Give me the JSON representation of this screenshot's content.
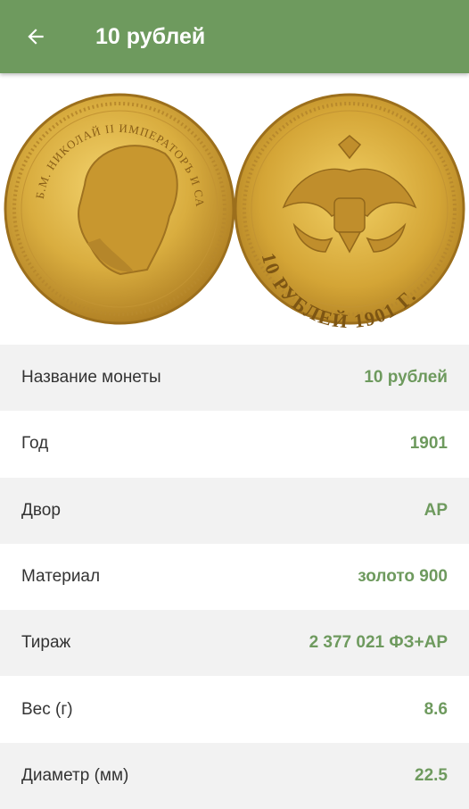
{
  "appbar": {
    "title": "10 рублей",
    "back_icon": "arrow-left-icon",
    "background": "#6e9a5e"
  },
  "coin_images": {
    "obverse_legend": "Б.М. НИКОЛАЙ II ИМПЕРАТОРЪ И САМОДЕРЖЕЦЪ ВСЕРОСС.",
    "reverse_legend": "10 РУБЛЕЙ 1901 Г."
  },
  "details": [
    {
      "label": "Название монеты",
      "value": "10 рублей"
    },
    {
      "label": "Год",
      "value": "1901"
    },
    {
      "label": "Двор",
      "value": "АР"
    },
    {
      "label": "Материал",
      "value": "золото 900"
    },
    {
      "label": "Тираж",
      "value": "2 377 021 ФЗ+АР"
    },
    {
      "label": "Вес (г)",
      "value": "8.6"
    },
    {
      "label": "Диаметр (мм)",
      "value": "22.5"
    }
  ],
  "colors": {
    "accent": "#6e9a5e",
    "row_alt": "#f2f2f2",
    "label_text": "#333333",
    "gold": "#d6ad3c"
  }
}
